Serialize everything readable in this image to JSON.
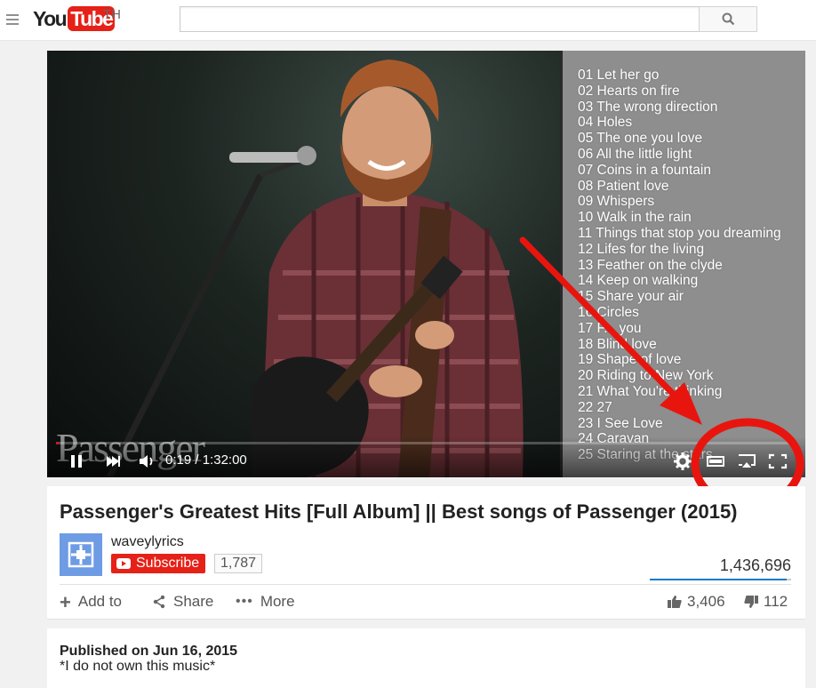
{
  "header": {
    "logo_you": "You",
    "logo_tube": "Tube",
    "country": "TH",
    "search_value": "",
    "icons": {
      "menu": "hamburger-menu-icon",
      "search": "search-icon"
    }
  },
  "player": {
    "watermark": "Passenger",
    "time_current": "0:19",
    "time_separator": "/",
    "time_total": "1:32:00",
    "progress_fraction": 0.0034,
    "tracklist": [
      "01 Let her go",
      "02 Hearts on fire",
      "03 The wrong direction",
      "04 Holes",
      "05 The one you love",
      "06 All the little light",
      "07 Coins in a fountain",
      "08 Patient love",
      "09 Whispers",
      "10 Walk in the rain",
      "11 Things that stop you dreaming",
      "12 Lifes for the living",
      "13 Feather on the clyde",
      "14 Keep on walking",
      "15 Share your air",
      "16 Circles",
      "17 F... you",
      "18 Blind love",
      "19 Shape of love",
      "20 Riding to New York",
      "21 What You're thinking",
      "22 27",
      "23 I See Love",
      "24 Caravan",
      "25 Staring at the stars"
    ],
    "icons": {
      "pause": "pause-icon",
      "next": "next-icon",
      "volume": "volume-icon",
      "settings": "gear-icon",
      "theater": "theater-mode-icon",
      "airplay": "airplay-icon",
      "fullscreen": "fullscreen-icon"
    },
    "colors": {
      "progress": "#cc181e",
      "annotation": "#e8150f"
    }
  },
  "video": {
    "title": "Passenger's Greatest Hits [Full Album] || Best songs of Passenger (2015)",
    "channel_name": "waveylyrics",
    "subscribe_label": "Subscribe",
    "subscriber_count": "1,787",
    "view_count": "1,436,696",
    "actions": {
      "add_to": "Add to",
      "share": "Share",
      "more": "More"
    },
    "likes": "3,406",
    "dislikes": "112",
    "like_fraction": 0.968
  },
  "description": {
    "published": "Published on Jun 16, 2015",
    "text": "*I do not own this music*"
  }
}
